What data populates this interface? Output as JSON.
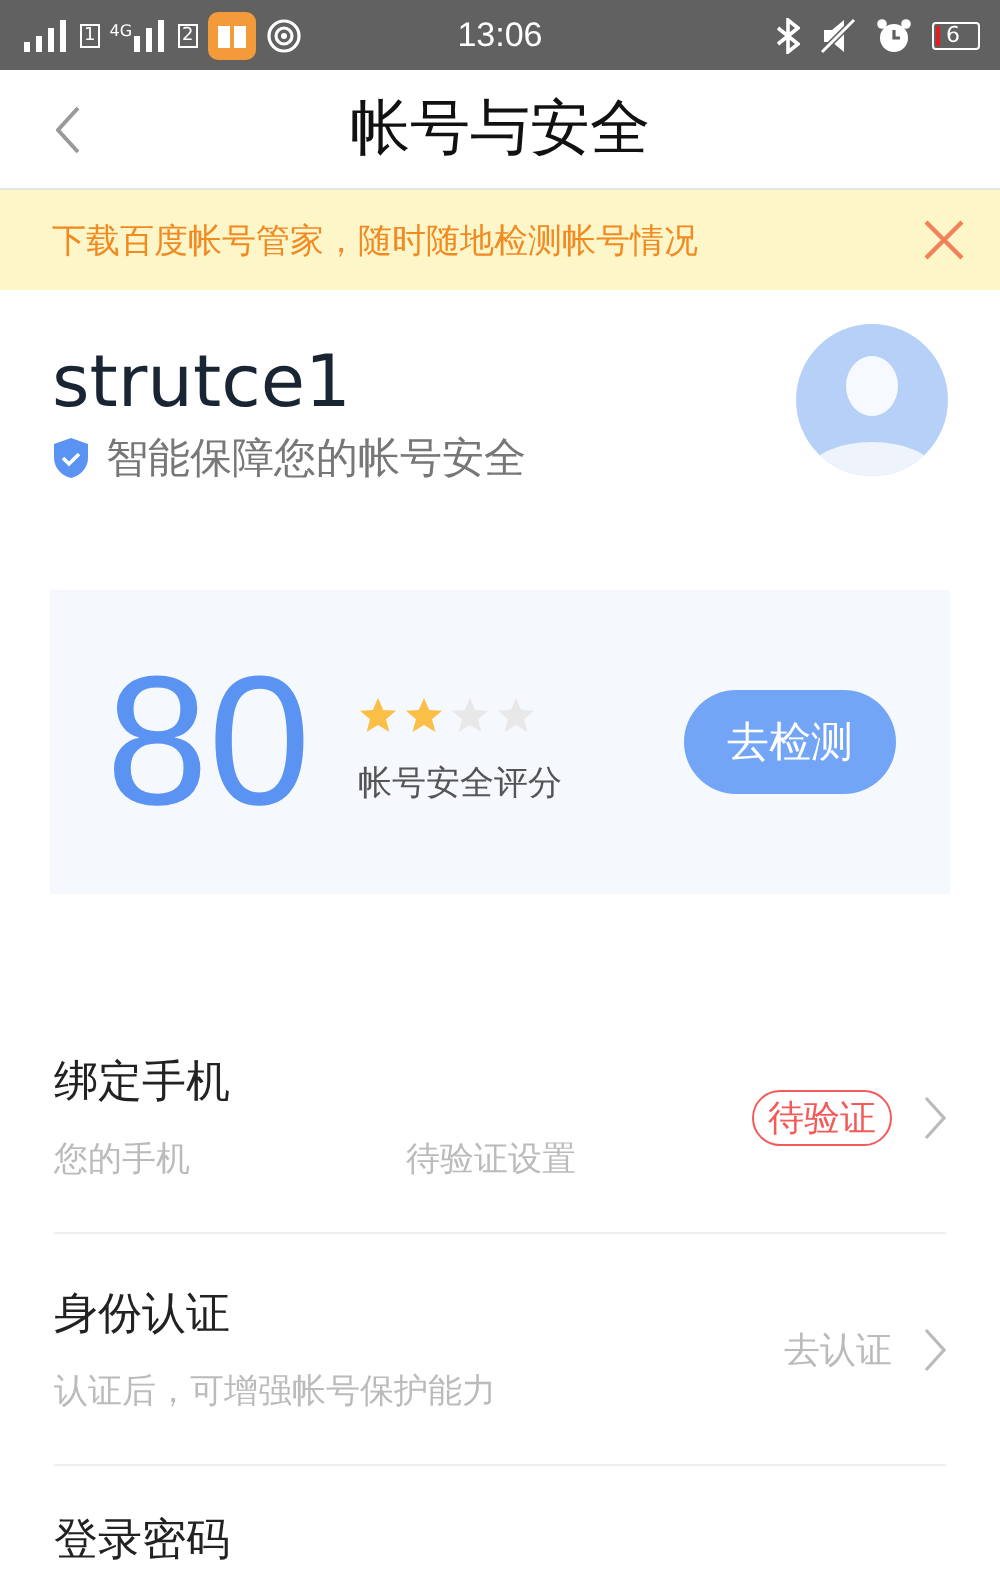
{
  "status_bar": {
    "sim_1": "1",
    "network": "4G",
    "sim_2": "2",
    "time": "13:06",
    "battery": "6"
  },
  "nav": {
    "title": "帐号与安全"
  },
  "banner": {
    "text": "下载百度帐号管家，随时随地检测帐号情况"
  },
  "profile": {
    "username": "strutce1",
    "tagline": "智能保障您的帐号安全"
  },
  "score": {
    "value": "80",
    "stars": 2,
    "label": "帐号安全评分",
    "button": "去检测"
  },
  "rows": [
    {
      "title": "绑定手机",
      "subtitle": "您的手机",
      "subtitle_2": "待验证设置",
      "badge": "待验证"
    },
    {
      "title": "身份认证",
      "subtitle": "认证后，可增强帐号保护能力",
      "action": "去认证"
    },
    {
      "title": "登录密码"
    }
  ]
}
